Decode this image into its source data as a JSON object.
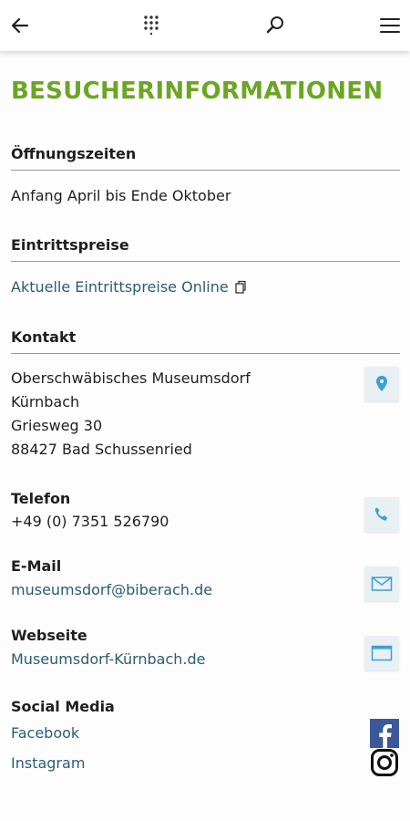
{
  "header": {
    "back_icon": "arrow-left-icon",
    "grid_icon": "apps-grid-icon",
    "search_icon": "search-icon",
    "menu_icon": "hamburger-menu-icon"
  },
  "page": {
    "title": "BESUCHERINFORMATIONEN"
  },
  "opening": {
    "heading": "Öffnungszeiten",
    "text": "Anfang April bis Ende Oktober"
  },
  "prices": {
    "heading": "Eintrittspreise",
    "link_text": "Aktuelle Eintrittspreise Online"
  },
  "contact": {
    "heading": "Kontakt",
    "address_lines": [
      "Oberschwäbisches Museumsdorf",
      "Kürnbach",
      "Griesweg 30",
      "88427 Bad Schussenried"
    ],
    "phone_label": "Telefon",
    "phone_value": "+49 (0) 7351 526790",
    "email_label": "E-Mail",
    "email_value": "museumsdorf@biberach.de",
    "website_label": "Webseite",
    "website_value": "Museumsdorf-Kürnbach.de",
    "social_label": "Social Media",
    "social_links": [
      "Facebook",
      "Instagram"
    ]
  },
  "colors": {
    "title_green": "#6ca524",
    "link_blue": "#2b5c76",
    "icon_blue": "#3b9fd6",
    "facebook_blue": "#3b5998"
  }
}
